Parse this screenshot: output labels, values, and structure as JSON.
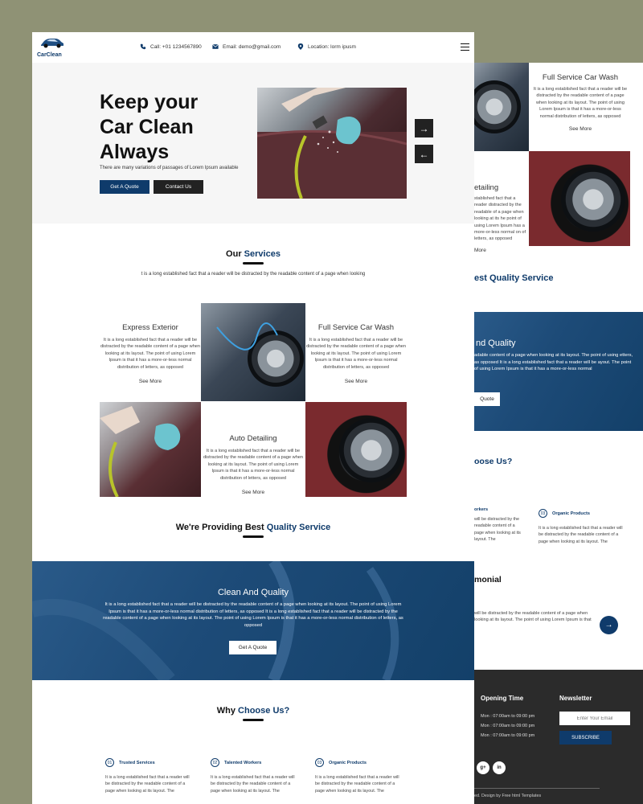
{
  "brand": {
    "name": "CarClean"
  },
  "colors": {
    "navy": "#0f3b6b",
    "dark": "#222222",
    "olive_bg": "#8f9275"
  },
  "contact": {
    "phone": "Call: +01 1234567890",
    "email": "Email: demo@gmail.com",
    "location": "Location: lorm ipusm"
  },
  "hero": {
    "title": "Keep your Car Clean Always",
    "subtitle": "There are many variations of passages of Lorem Ipsum available",
    "btn_quote": "Get A Quote",
    "btn_contact": "Contact Us",
    "next_arrow": "→",
    "prev_arrow": "←"
  },
  "services": {
    "title_plain": "Our ",
    "title_hl": "Services",
    "desc": "t is a long established fact that a reader will be distracted by the readable content of a page when looking",
    "cards": [
      {
        "title": "Express Exterior",
        "body": "It is a long established fact that a reader will be distracted by the readable content of a page when looking at its layout. The point of using Lorem Ipsum is that it has a more-or-less normal distribution of letters, as opposed",
        "more": "See More"
      },
      {
        "title": "Full Service Car Wash",
        "body": "It is a long established fact that a reader will be distracted by the readable content of a page when looking at its layout. The point of using Lorem Ipsum is that it has a more-or-less normal distribution of letters, as opposed",
        "more": "See More"
      },
      {
        "title": "Auto Detailing",
        "body": "It is a long established fact that a reader will be distracted by the readable content of a page when looking at its layout. The point of using Lorem Ipsum is that it has a more-or-less normal distribution of letters, as opposed",
        "more": "See More"
      }
    ]
  },
  "quality": {
    "title_plain": "We're Providing ",
    "title_mid": "Best ",
    "title_hl": "Quality Service"
  },
  "banner": {
    "title": "Clean And Quality",
    "body": "It is a long established fact that a reader will be distracted by the readable content of a page when looking at its layout. The point of using Lorem Ipsum is that it has a more-or-less normal distribution of letters, as opposed It is a long established fact that a reader will be distracted by the readable content of a page when looking at its layout. The point of using Lorem Ipsum is that it has a more-or-less normal distribution of letters, as opposed",
    "btn": "Get A Quote"
  },
  "why": {
    "title_plain": "Why ",
    "title_hl": "Choose Us?",
    "items": [
      {
        "num": "01",
        "head": "Trusted Services",
        "body": "It is a long established fact that a reader will be distracted by the readable content of a page when looking at its layout. The"
      },
      {
        "num": "02",
        "head": "Talented Workers",
        "body": "It is a long established fact that a reader will be distracted by the readable content of a page when looking at its layout. The"
      },
      {
        "num": "03",
        "head": "Organic Products",
        "body": "It is a long established fact that a reader will be distracted by the readable content of a page when looking at its layout. The"
      }
    ]
  },
  "back": {
    "card_title": "Full Service Car Wash",
    "card_body": "It is a long established fact that a reader will be distracted by the readable content of a page when looking at its layout. The point of using Lorem Ipsum is that it has a more-or-less normal distribution of letters, as opposed",
    "card_more": "See More",
    "partial_detailing": "etailing",
    "partial_body": "stablished fact that a reader distracted by the readable of a page when looking at its he point of using Lorem Ipsum has a more-or-less normal on of letters, as opposed",
    "partial_more": "More",
    "quality_partial": "est Quality Service",
    "banner_title_partial": "nd Quality",
    "banner_body_partial": "adable content of a page when looking at its layout. The point of using etters, as opposed It is a long established fact that a reader will be ayout. The point of using Lorem Ipsum is that it has a more-or-less normal",
    "banner_btn_partial": "Quote",
    "why_partial": "oose Us?",
    "workers_partial": "orkers",
    "workers_body_partial": "will be distracted by the readable content of a page when looking at its layout. The",
    "organic_num": "03",
    "organic_head": "Organic Products",
    "organic_body": "It is a long established fact that a reader will be distracted by the readable content of a page when looking at its layout. The",
    "testimonial_partial": "monial",
    "testimonial_body": "will be distracted by the readable content of a page when looking at its layout. The point of using Lorem Ipsum is that",
    "testimonial_arrow": "→",
    "opening_title": "Opening Time",
    "opening_rows": [
      "Mon : 07:00am to 09:00 pm",
      "Mon : 07:00am to 09:00 pm",
      "Mon : 07:00am to 09:00 pm"
    ],
    "newsletter_title": "Newsletter",
    "newsletter_placeholder": "Enter Your Email",
    "subscribe": "SUBSCRIBE",
    "social_g": "g+",
    "social_in": "in",
    "copyright_partial": "ed. Design by Free html Templates"
  }
}
